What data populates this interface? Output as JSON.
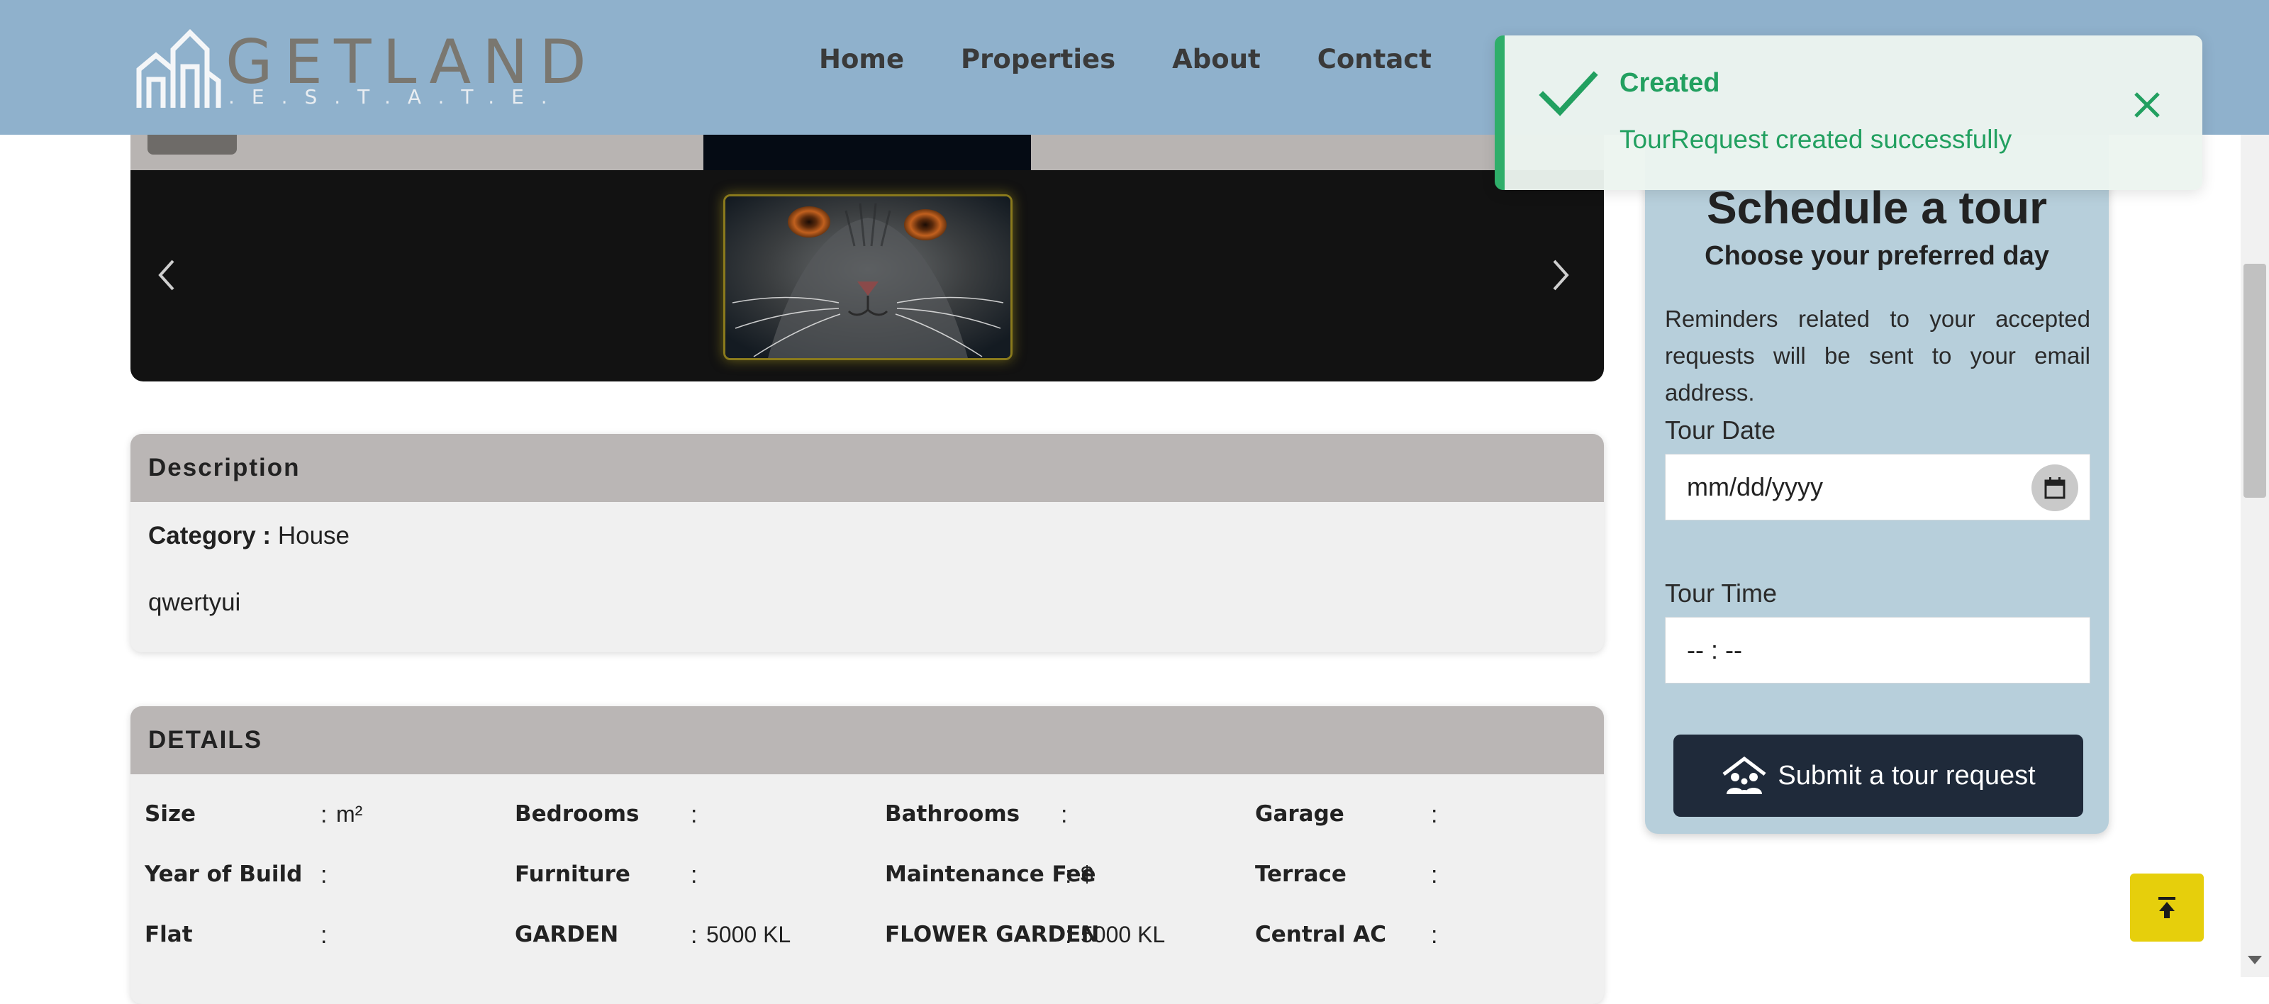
{
  "header": {
    "logo_text": "GETLAND",
    "logo_sub": ".E.S.T.A.T.E.",
    "nav": [
      "Home",
      "Properties",
      "About",
      "Contact"
    ]
  },
  "toast": {
    "title": "Created",
    "message": "TourRequest created successfully",
    "icon": "check-icon",
    "accent_color": "#2fae6a"
  },
  "carousel": {
    "prev_icon": "chevron-left-icon",
    "next_icon": "chevron-right-icon"
  },
  "description": {
    "heading": "Description",
    "category_label": "Category :",
    "category_value": "House",
    "text": "qwertyui"
  },
  "details": {
    "heading": "DETAILS",
    "rows": [
      [
        {
          "label": "Size",
          "value": "m²"
        },
        {
          "label": "Bedrooms",
          "value": ""
        },
        {
          "label": "Bathrooms",
          "value": ""
        },
        {
          "label": "Garage",
          "value": ""
        }
      ],
      [
        {
          "label": "Year of Build",
          "value": ""
        },
        {
          "label": "Furniture",
          "value": ""
        },
        {
          "label": "Maintenance Fee",
          "value": "$"
        },
        {
          "label": "Terrace",
          "value": ""
        }
      ],
      [
        {
          "label": "Flat",
          "value": ""
        },
        {
          "label": "GARDEN",
          "value": "5000 KL"
        },
        {
          "label": "FLOWER GARDEN",
          "value": "5000 KL"
        },
        {
          "label": "Central AC",
          "value": ""
        }
      ]
    ]
  },
  "tour": {
    "title": "Schedule a tour",
    "subtitle": "Choose your preferred day",
    "note": "Reminders related to your accepted requests will be sent to your email address.",
    "date_label": "Tour Date",
    "date_placeholder": "mm/dd/yyyy",
    "time_label": "Tour Time",
    "time_placeholder": "-- : --",
    "submit_label": "Submit a tour request",
    "submit_color": "#1f2a3a",
    "panel_color": "#b7cfdb"
  },
  "back_to_top": {
    "icon": "arrow-up-to-line-icon",
    "color": "#e6cf0c"
  }
}
